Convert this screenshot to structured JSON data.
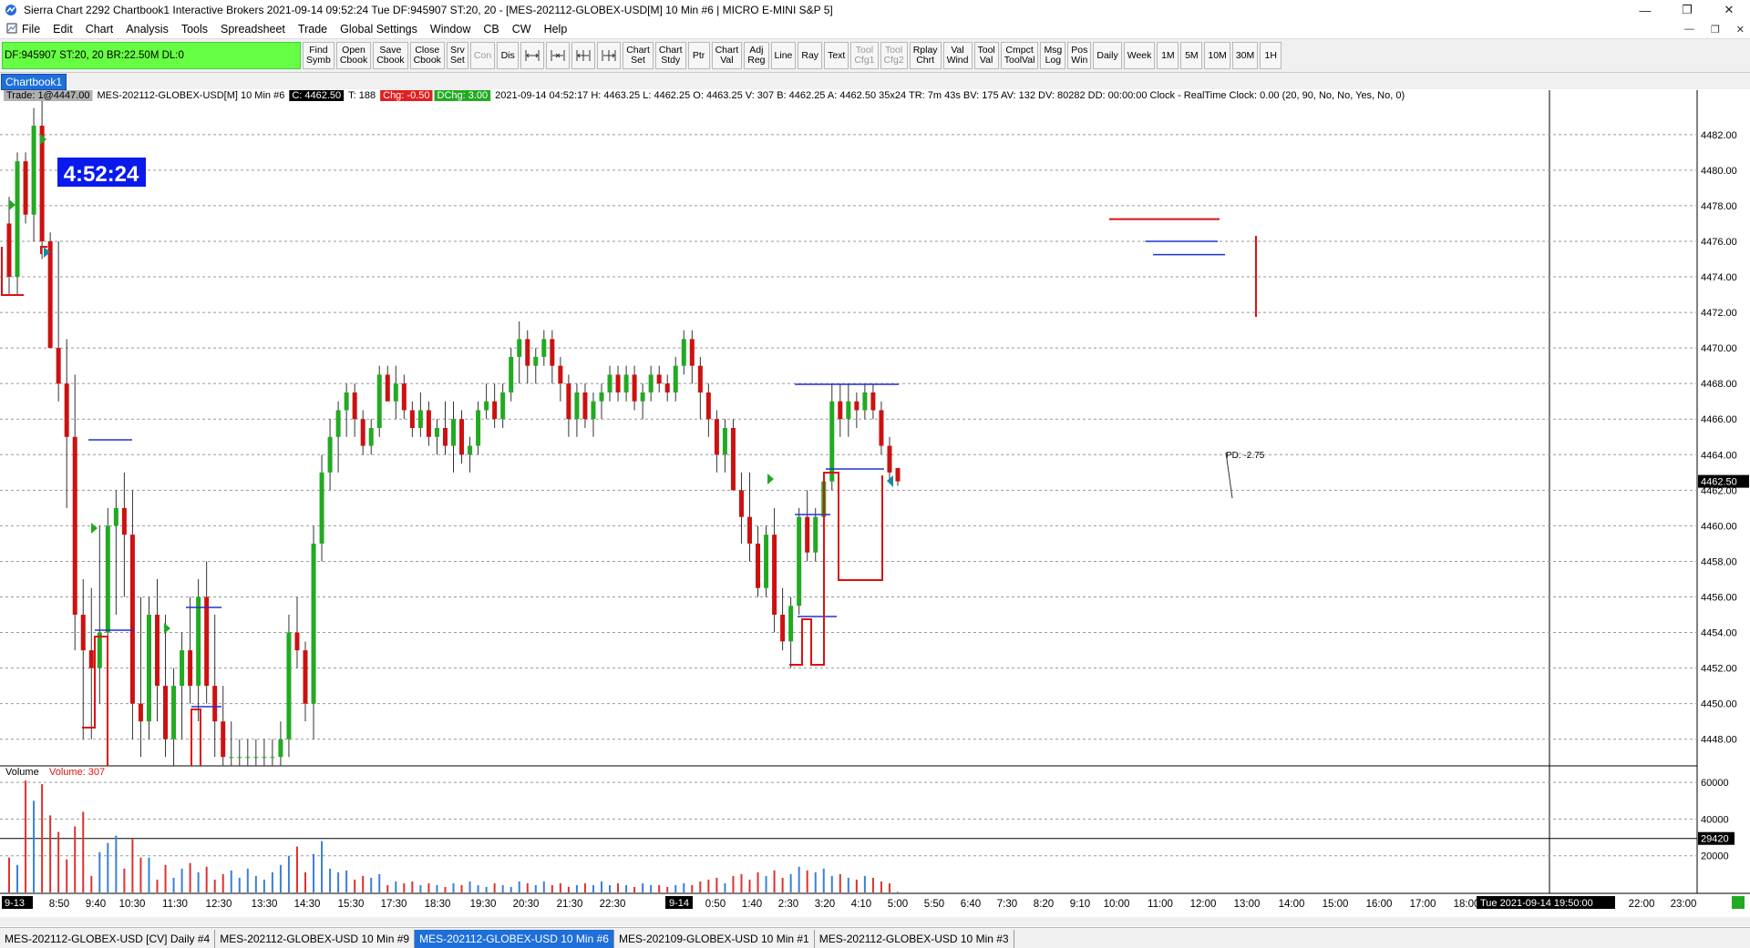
{
  "window": {
    "title": "Sierra Chart 2292 Chartbook1  Interactive Brokers 2021-09-14  09:52:24 Tue  DF:945907  ST:20, 20 - [MES-202112-GLOBEX-USD[M]  10 Min  #6 | MICRO E-MINI S&P 5]",
    "minimize": "—",
    "maximize": "❐",
    "close": "✕"
  },
  "menu": {
    "items": [
      "File",
      "Edit",
      "Chart",
      "Analysis",
      "Tools",
      "Spreadsheet",
      "Trade",
      "Global Settings",
      "Window",
      "CB",
      "CW",
      "Help"
    ],
    "mdi_min": "—",
    "mdi_restore": "❐",
    "mdi_close": "✕"
  },
  "toolbar": {
    "df_status": "DF:945907  ST:20, 20  BR:22.50M  DL:0",
    "df_color": "#66ff44",
    "buttons": [
      {
        "l1": "Find",
        "l2": "Symb"
      },
      {
        "l1": "Open",
        "l2": "Cbook"
      },
      {
        "l1": "Save",
        "l2": "Cbook"
      },
      {
        "l1": "Close",
        "l2": "Cbook"
      },
      {
        "l1": "Srv",
        "l2": "Set"
      },
      {
        "l1": "Con",
        "l2": ""
      },
      {
        "l1": "Dis",
        "l2": ""
      }
    ],
    "buttons2": [
      {
        "l1": "Chart",
        "l2": "Set"
      },
      {
        "l1": "Chart",
        "l2": "Stdy"
      },
      {
        "l1": "Ptr",
        "l2": ""
      },
      {
        "l1": "Chart",
        "l2": "Val"
      },
      {
        "l1": "Adj",
        "l2": "Reg"
      },
      {
        "l1": "Line",
        "l2": ""
      },
      {
        "l1": "Ray",
        "l2": ""
      },
      {
        "l1": "Text",
        "l2": ""
      },
      {
        "l1": "Tool",
        "l2": "Cfg1"
      },
      {
        "l1": "Tool",
        "l2": "Cfg2"
      },
      {
        "l1": "Rplay",
        "l2": "Chrt"
      },
      {
        "l1": "Val",
        "l2": "Wind"
      },
      {
        "l1": "Tool",
        "l2": "Val"
      },
      {
        "l1": "Cmpct",
        "l2": "ToolVal"
      },
      {
        "l1": "Msg",
        "l2": "Log"
      },
      {
        "l1": "Pos",
        "l2": "Win"
      },
      {
        "l1": "Daily",
        "l2": ""
      },
      {
        "l1": "Week",
        "l2": ""
      },
      {
        "l1": "1M",
        "l2": ""
      },
      {
        "l1": "5M",
        "l2": ""
      },
      {
        "l1": "10M",
        "l2": ""
      },
      {
        "l1": "30M",
        "l2": ""
      },
      {
        "l1": "1H",
        "l2": ""
      }
    ]
  },
  "chartbook_tab": "Chartbook1",
  "chart": {
    "info_trade": "Trade: 1@4447.00",
    "info_symbol": "MES-202112-GLOBEX-USD[M]  10 Min  #6",
    "info_close": "C: 4462.50",
    "info_ticks": "T: 188",
    "info_chg": "Chg: -0.50",
    "info_dchg": "DChg: 3.00",
    "info_rest": "2021-09-14 04:52:17 H: 4463.25 L: 4462.25 O: 4463.25 V: 307 B: 4462.25 A: 4462.50 35x24 TR: 7m 43s BV: 175 AV: 132 DV: 80282 DD: 00:00:00 Clock - RealTime  Clock: 0.00   (20, 90, No, No, Yes, No, 0)",
    "clock": "4:52:24",
    "pd_label": "PD: -2.75",
    "volume_label": "Volume",
    "volume_value": "Volume: 307",
    "price_marker": "4462.50",
    "volume_marker": "29420",
    "date_marker_left": "9-13",
    "date_marker_mid": "9-14",
    "date_marker_right": "Tue 2021-09-14  19:50:00",
    "price_ticks": [
      "4482.00",
      "4480.00",
      "4478.00",
      "4476.00",
      "4474.00",
      "4472.00",
      "4470.00",
      "4468.00",
      "4466.00",
      "4464.00",
      "4462.00",
      "4460.00",
      "4458.00",
      "4456.00",
      "4454.00",
      "4452.00",
      "4450.00",
      "4448.00"
    ],
    "volume_ticks": [
      "60000",
      "40000",
      "20000"
    ],
    "time_ticks": [
      "8:50",
      "9:40",
      "10:30",
      "11:30",
      "12:30",
      "13:30",
      "14:30",
      "15:30",
      "17:30",
      "18:30",
      "19:30",
      "20:30",
      "21:30",
      "22:30",
      "0:50",
      "1:40",
      "2:30",
      "3:20",
      "4:10",
      "5:00",
      "5:50",
      "6:40",
      "7:30",
      "8:20",
      "9:10",
      "10:00",
      "11:00",
      "12:00",
      "13:00",
      "14:00",
      "15:00",
      "16:00",
      "17:00",
      "18:00",
      "22:00",
      "23:00"
    ]
  },
  "chart_data": {
    "type": "candlestick",
    "symbol": "MES-202112-GLOBEX-USD[M]",
    "interval": "10 Min",
    "ylim": [
      4446.5,
      4484.5
    ],
    "volume_ylim": [
      0,
      66000
    ],
    "up_color": "#22aa22",
    "down_color": "#cc1111",
    "candles": [
      [
        4477,
        4478.5,
        4473,
        4474
      ],
      [
        4474,
        4481,
        4473,
        4480.5
      ],
      [
        4480.5,
        4481,
        4477,
        4477.5
      ],
      [
        4477.5,
        4483.5,
        4476,
        4482.5
      ],
      [
        4482.5,
        4484,
        4475,
        4476
      ],
      [
        4476,
        4476.5,
        4470,
        4470
      ],
      [
        4470,
        4476,
        4467,
        4468
      ],
      [
        4468,
        4470.5,
        4461,
        4465
      ],
      [
        4465,
        4468.5,
        4453,
        4455
      ],
      [
        4455,
        4457,
        4448,
        4453
      ],
      [
        4453,
        4456.5,
        4448,
        4452
      ],
      [
        4452,
        4460,
        4450,
        4454
      ],
      [
        4454,
        4461,
        4451,
        4460
      ],
      [
        4460,
        4462,
        4455,
        4461
      ],
      [
        4461,
        4463,
        4456,
        4459.5
      ],
      [
        4459.5,
        4462,
        4448,
        4450
      ],
      [
        4450,
        4456,
        4447,
        4449
      ],
      [
        4449,
        4456,
        4448,
        4455
      ],
      [
        4455,
        4457,
        4449,
        4451
      ],
      [
        4451,
        4455,
        4447,
        4448
      ],
      [
        4448,
        4452,
        4446,
        4451
      ],
      [
        4451,
        4454,
        4448,
        4453
      ],
      [
        4453,
        4456,
        4450,
        4451
      ],
      [
        4451,
        4457,
        4449,
        4456
      ],
      [
        4456,
        4458,
        4450,
        4451
      ],
      [
        4451,
        4455,
        4447,
        4449
      ],
      [
        4449,
        4451,
        4446,
        4447
      ],
      [
        4447,
        4449,
        4446,
        4447
      ],
      [
        4447,
        4448,
        4446,
        4447
      ],
      [
        4447,
        4448,
        4446,
        4447
      ],
      [
        4447,
        4448,
        4446,
        4447
      ],
      [
        4447,
        4448,
        4446,
        4447
      ],
      [
        4447,
        4448,
        4446,
        4447
      ],
      [
        4447,
        4449,
        4446,
        4448
      ],
      [
        4448,
        4455,
        4447,
        4454
      ],
      [
        4454,
        4456,
        4452,
        4453
      ],
      [
        4453,
        4453.5,
        4449,
        4450
      ],
      [
        4450,
        4460,
        4448,
        4459
      ],
      [
        4459,
        4464,
        4458,
        4463
      ],
      [
        4463,
        4466,
        4462,
        4465
      ],
      [
        4465,
        4467,
        4463,
        4466.5
      ],
      [
        4466.5,
        4468,
        4465,
        4467.5
      ],
      [
        4467.5,
        4468,
        4465,
        4466
      ],
      [
        4466,
        4466.5,
        4464,
        4464.5
      ],
      [
        4464.5,
        4466,
        4464,
        4465.5
      ],
      [
        4465.5,
        4469,
        4465,
        4468.5
      ],
      [
        4468.5,
        4469,
        4467,
        4467
      ],
      [
        4467,
        4469,
        4466,
        4468
      ],
      [
        4468,
        4468.5,
        4466,
        4466.5
      ],
      [
        4466.5,
        4467,
        4465,
        4465.5
      ],
      [
        4465.5,
        4467.5,
        4465,
        4466.5
      ],
      [
        4466.5,
        4467,
        4464.5,
        4465
      ],
      [
        4465,
        4466,
        4464,
        4465.5
      ],
      [
        4465.5,
        4467,
        4464,
        4464.5
      ],
      [
        4464.5,
        4467,
        4463,
        4466
      ],
      [
        4466,
        4466.5,
        4463.5,
        4464
      ],
      [
        4464,
        4465,
        4463,
        4464.5
      ],
      [
        4464.5,
        4467,
        4464,
        4466.5
      ],
      [
        4466.5,
        4468,
        4466,
        4467
      ],
      [
        4467,
        4468,
        4465.5,
        4466
      ],
      [
        4466,
        4468,
        4465.5,
        4467.5
      ],
      [
        4467.5,
        4470,
        4467,
        4469.5
      ],
      [
        4469.5,
        4471.5,
        4468,
        4470.5
      ],
      [
        4470.5,
        4471,
        4468,
        4469
      ],
      [
        4469,
        4470,
        4468,
        4469.5
      ],
      [
        4469.5,
        4471,
        4469,
        4470.5
      ],
      [
        4470.5,
        4471,
        4468,
        4469
      ],
      [
        4469,
        4469.5,
        4467,
        4468
      ],
      [
        4468,
        4468.5,
        4465,
        4466
      ],
      [
        4466,
        4468,
        4465,
        4467.5
      ],
      [
        4467.5,
        4468,
        4465.5,
        4466
      ],
      [
        4466,
        4467.5,
        4465,
        4467
      ],
      [
        4467,
        4468,
        4466,
        4467.5
      ],
      [
        4467.5,
        4469,
        4467,
        4468.5
      ],
      [
        4468.5,
        4469,
        4467,
        4467.5
      ],
      [
        4467.5,
        4469,
        4467,
        4468.5
      ],
      [
        4468.5,
        4469,
        4466.5,
        4467
      ],
      [
        4467,
        4468,
        4466,
        4467.5
      ],
      [
        4467.5,
        4469,
        4467,
        4468.5
      ],
      [
        4468.5,
        4469,
        4467.5,
        4468
      ],
      [
        4468,
        4468.5,
        4467,
        4467.5
      ],
      [
        4467.5,
        4469.5,
        4467,
        4469
      ],
      [
        4469,
        4471,
        4468.5,
        4470.5
      ],
      [
        4470.5,
        4471,
        4468,
        4469
      ],
      [
        4469,
        4469.5,
        4466,
        4467.5
      ],
      [
        4467.5,
        4468,
        4465,
        4466
      ],
      [
        4466,
        4466.5,
        4463,
        4464
      ],
      [
        4464,
        4466,
        4463,
        4465.5
      ],
      [
        4465.5,
        4466,
        4462,
        4462
      ],
      [
        4462,
        4463,
        4459,
        4460.5
      ],
      [
        4460.5,
        4463,
        4458,
        4459
      ],
      [
        4459,
        4460,
        4456,
        4456.5
      ],
      [
        4456.5,
        4460,
        4456,
        4459.5
      ],
      [
        4459.5,
        4461,
        4454,
        4455
      ],
      [
        4455,
        4456.5,
        4453,
        4453.5
      ],
      [
        4453.5,
        4456,
        4452,
        4455.5
      ],
      [
        4455.5,
        4461,
        4455,
        4460.5
      ],
      [
        4460.5,
        4462,
        4458,
        4458.5
      ],
      [
        4458.5,
        4461,
        4458,
        4460.5
      ],
      [
        4460.5,
        4463,
        4460,
        4462.5
      ],
      [
        4462.5,
        4468,
        4462,
        4467
      ],
      [
        4467,
        4468,
        4465,
        4466
      ],
      [
        4466,
        4468,
        4465,
        4467
      ],
      [
        4467,
        4467.5,
        4465.5,
        4466.5
      ],
      [
        4466.5,
        4468,
        4466,
        4467.5
      ],
      [
        4467.5,
        4468,
        4466,
        4466.5
      ],
      [
        4466.5,
        4467,
        4464,
        4464.5
      ],
      [
        4464.5,
        4465,
        4462.5,
        4463
      ],
      [
        4463.25,
        4463.25,
        4462.25,
        4462.5
      ]
    ],
    "volume": [
      19000,
      15000,
      61000,
      50000,
      59000,
      42000,
      33000,
      18000,
      36000,
      44000,
      9000,
      22000,
      27000,
      31000,
      13000,
      29000,
      19000,
      19000,
      7000,
      15000,
      8000,
      13000,
      16000,
      11000,
      14000,
      7000,
      10000,
      12000,
      8000,
      13000,
      9000,
      7000,
      11000,
      15000,
      20000,
      25000,
      11000,
      21000,
      28000,
      13000,
      11000,
      12000,
      7000,
      9000,
      8000,
      10000,
      4000,
      6000,
      5000,
      6000,
      4000,
      5000,
      4000,
      3000,
      5000,
      4000,
      6000,
      4000,
      3000,
      5000,
      4000,
      3000,
      6000,
      5000,
      4000,
      6000,
      4000,
      5000,
      3000,
      4000,
      5000,
      4000,
      6000,
      4000,
      5000,
      4000,
      3000,
      5000,
      4000,
      4000,
      3000,
      4000,
      5000,
      4000,
      6000,
      7000,
      8000,
      5000,
      9000,
      10000,
      7000,
      11000,
      9000,
      12000,
      8000,
      10000,
      14000,
      12000,
      11000,
      13000,
      9000,
      10000,
      8000,
      7000,
      9000,
      8000,
      6000,
      5000,
      307
    ],
    "levels": [
      {
        "price": 4477.25,
        "color": "#d11",
        "style": "solid"
      },
      {
        "price": 4476,
        "color": "#2233cc",
        "style": "solid"
      },
      {
        "price": 4475.25,
        "color": "#2233cc",
        "style": "solid"
      }
    ]
  }
}
